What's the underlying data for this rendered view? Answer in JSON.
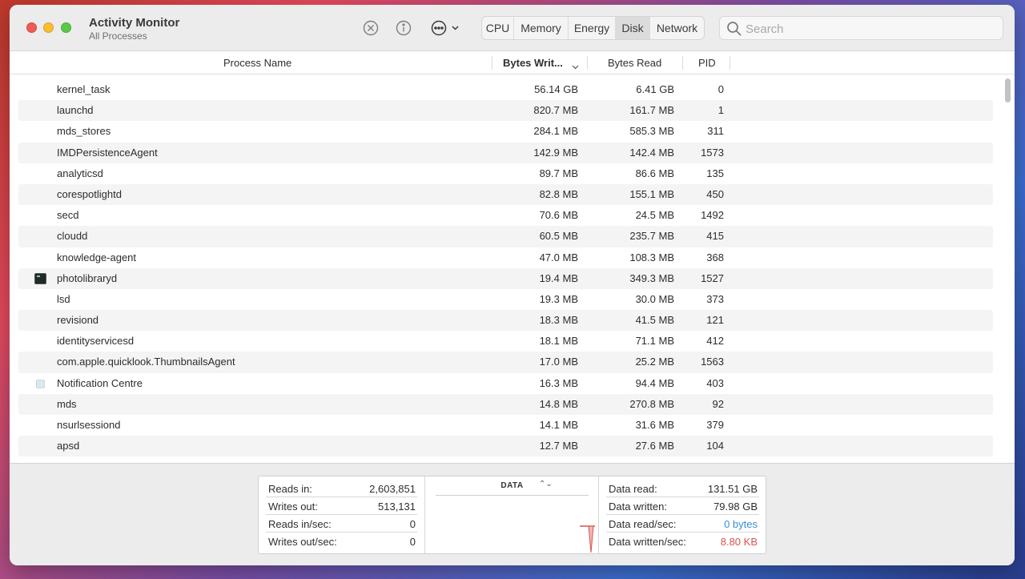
{
  "window": {
    "title": "Activity Monitor",
    "subtitle": "All Processes"
  },
  "toolbar": {
    "stop_icon": "x-circle-icon",
    "info_icon": "info-icon",
    "more_icon": "ellipsis-circle-icon",
    "tabs": [
      {
        "label": "CPU",
        "active": false
      },
      {
        "label": "Memory",
        "active": false
      },
      {
        "label": "Energy",
        "active": false
      },
      {
        "label": "Disk",
        "active": true
      },
      {
        "label": "Network",
        "active": false
      }
    ],
    "search": {
      "placeholder": "Search",
      "value": ""
    }
  },
  "table": {
    "columns": {
      "name": "Process Name",
      "bytes_written": "Bytes Writ...",
      "bytes_read": "Bytes Read",
      "pid": "PID"
    },
    "rows": [
      {
        "name": "kernel_task",
        "written": "56.14 GB",
        "read": "6.41 GB",
        "pid": "0"
      },
      {
        "name": "launchd",
        "written": "820.7 MB",
        "read": "161.7 MB",
        "pid": "1"
      },
      {
        "name": "mds_stores",
        "written": "284.1 MB",
        "read": "585.3 MB",
        "pid": "311"
      },
      {
        "name": "IMDPersistenceAgent",
        "written": "142.9 MB",
        "read": "142.4 MB",
        "pid": "1573"
      },
      {
        "name": "analyticsd",
        "written": "89.7 MB",
        "read": "86.6 MB",
        "pid": "135"
      },
      {
        "name": "corespotlightd",
        "written": "82.8 MB",
        "read": "155.1 MB",
        "pid": "450"
      },
      {
        "name": "secd",
        "written": "70.6 MB",
        "read": "24.5 MB",
        "pid": "1492"
      },
      {
        "name": "cloudd",
        "written": "60.5 MB",
        "read": "235.7 MB",
        "pid": "415"
      },
      {
        "name": "knowledge-agent",
        "written": "47.0 MB",
        "read": "108.3 MB",
        "pid": "368"
      },
      {
        "name": "photolibraryd",
        "written": "19.4 MB",
        "read": "349.3 MB",
        "pid": "1527",
        "icon": "terminal-icon"
      },
      {
        "name": "lsd",
        "written": "19.3 MB",
        "read": "30.0 MB",
        "pid": "373"
      },
      {
        "name": "revisiond",
        "written": "18.3 MB",
        "read": "41.5 MB",
        "pid": "121"
      },
      {
        "name": "identityservicesd",
        "written": "18.1 MB",
        "read": "71.1 MB",
        "pid": "412"
      },
      {
        "name": "com.apple.quicklook.ThumbnailsAgent",
        "written": "17.0 MB",
        "read": "25.2 MB",
        "pid": "1563"
      },
      {
        "name": "Notification Centre",
        "written": "16.3 MB",
        "read": "94.4 MB",
        "pid": "403",
        "icon": "notification-icon"
      },
      {
        "name": "mds",
        "written": "14.8 MB",
        "read": "270.8 MB",
        "pid": "92"
      },
      {
        "name": "nsurlsessiond",
        "written": "14.1 MB",
        "read": "31.6 MB",
        "pid": "379"
      },
      {
        "name": "apsd",
        "written": "12.7 MB",
        "read": "27.6 MB",
        "pid": "104"
      }
    ]
  },
  "footer": {
    "left": [
      {
        "label": "Reads in:",
        "value": "2,603,851"
      },
      {
        "label": "Writes out:",
        "value": "513,131"
      },
      {
        "label": "Reads in/sec:",
        "value": "0"
      },
      {
        "label": "Writes out/sec:",
        "value": "0"
      }
    ],
    "graph_title": "DATA",
    "graph_arrows": "⌃⌄",
    "right": [
      {
        "label": "Data read:",
        "value": "131.51 GB",
        "color": ""
      },
      {
        "label": "Data written:",
        "value": "79.98 GB",
        "color": ""
      },
      {
        "label": "Data read/sec:",
        "value": "0 bytes",
        "color": "#3b8fd4"
      },
      {
        "label": "Data written/sec:",
        "value": "8.80 KB",
        "color": "#d9534f"
      }
    ],
    "colors": {
      "read": "#3b8fd4",
      "written": "#d9534f"
    }
  }
}
